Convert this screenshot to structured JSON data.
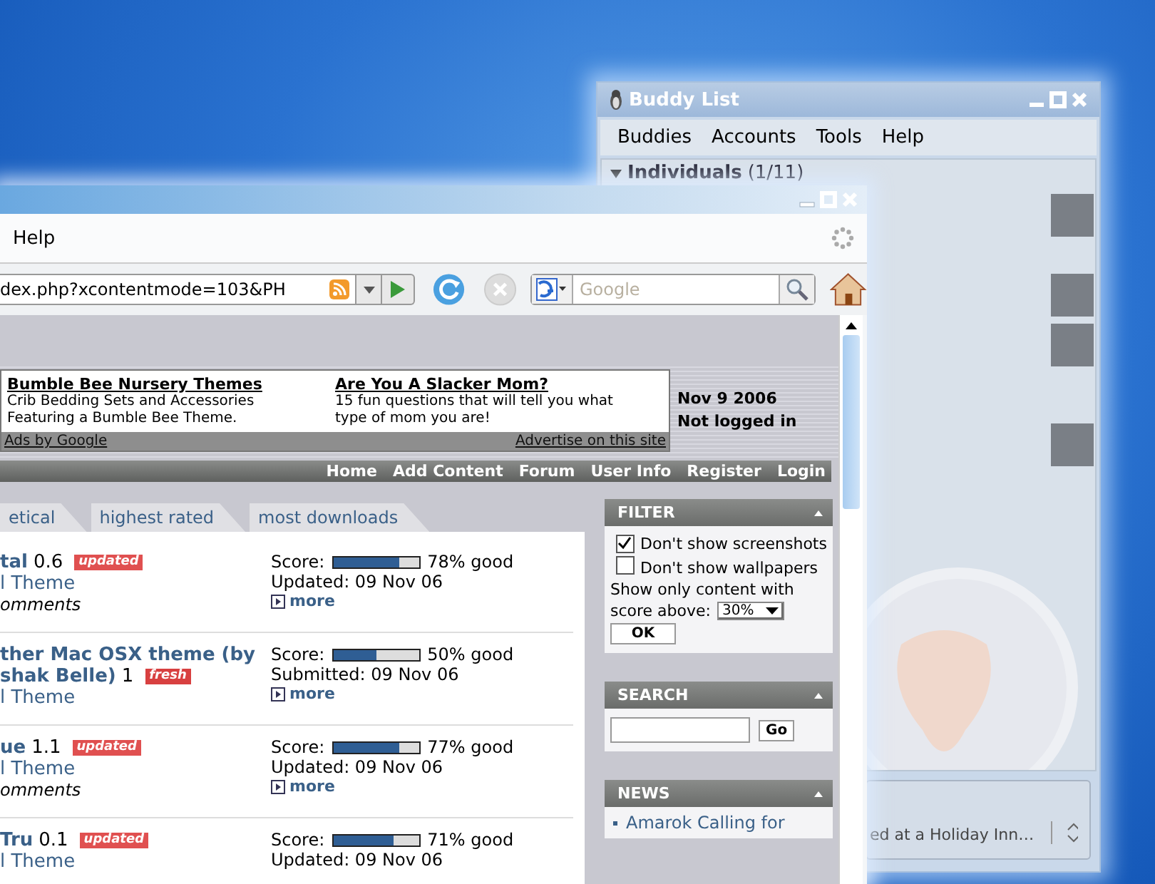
{
  "buddy_list": {
    "title": "Buddy List",
    "menu": [
      "Buddies",
      "Accounts",
      "Tools",
      "Help"
    ],
    "group": {
      "name": "Individuals",
      "count": "(1/11)",
      "expanded": true
    },
    "status": "ed at a Holiday Inn…"
  },
  "browser": {
    "menu": [
      "Help"
    ],
    "address": "dex.php?xcontentmode=103&PH",
    "search_placeholder": "Google",
    "ads": [
      {
        "title": "Bumble Bee Nursery Themes",
        "text": "Crib Bedding Sets and Accessories Featuring a Bumble Bee Theme."
      },
      {
        "title": "Are You A Slacker Mom?",
        "text": "15 fun questions that will tell you what type of mom you are!"
      }
    ],
    "ads_label": "Ads by Google",
    "advertise": "Advertise on this site",
    "date": "Nov 9 2006",
    "login_status": "Not logged in",
    "nav": [
      "Home",
      "Add Content",
      "Forum",
      "User Info",
      "Register",
      "Login"
    ],
    "tabs": [
      {
        "label": "etical",
        "selected": false
      },
      {
        "label": "highest rated",
        "selected": false
      },
      {
        "label": "most downloads",
        "selected": false
      }
    ],
    "items": [
      {
        "title_lines": [
          "tal"
        ],
        "version": "0.6",
        "badge": {
          "kind": "updated",
          "text": "updated"
        },
        "category": "l Theme",
        "comments": "omments",
        "score_label": "Score:",
        "level": 0.78,
        "score_text": "78% good",
        "date": "Updated: 09 Nov 06",
        "more": "more"
      },
      {
        "title_lines": [
          "ther Mac OSX theme (by",
          "shak Belle)"
        ],
        "version": "1",
        "badge": {
          "kind": "fresh",
          "text": "fresh"
        },
        "category": "l Theme",
        "score_label": "Score:",
        "level": 0.5,
        "score_text": "50% good",
        "date": "Submitted: 09 Nov 06",
        "more": "more"
      },
      {
        "title_lines": [
          "ue"
        ],
        "version": "1.1",
        "badge": {
          "kind": "updated",
          "text": "updated"
        },
        "category": "l Theme",
        "comments": "omments",
        "score_label": "Score:",
        "level": 0.77,
        "score_text": "77% good",
        "date": "Updated: 09 Nov 06",
        "more": "more"
      },
      {
        "title_lines": [
          "Tru"
        ],
        "version": "0.1",
        "badge": {
          "kind": "updated",
          "text": "updated"
        },
        "category": "l Theme",
        "score_label": "Score:",
        "level": 0.71,
        "score_text": "71% good",
        "date": "Updated: 09 Nov 06"
      }
    ],
    "filter": {
      "title": "FILTER",
      "options": [
        {
          "label": "Don't show screenshots",
          "checked": true
        },
        {
          "label": "Don't show wallpapers",
          "checked": false
        }
      ],
      "score_label_lines": [
        "Show only content with",
        "score above:"
      ],
      "score_value": "30%",
      "ok": "OK"
    },
    "search": {
      "title": "SEARCH",
      "button": "Go"
    },
    "news": {
      "title": "NEWS",
      "items": [
        "Amarok Calling for"
      ]
    }
  }
}
